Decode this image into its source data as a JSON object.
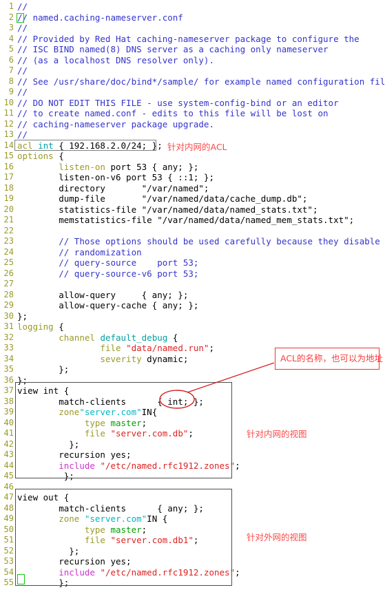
{
  "editor": {
    "name": "text-editor",
    "file_hint": "named.caching-nameserver.conf",
    "gutter_color": "#9a9a2a",
    "cursor_color": "#17c417",
    "annotation_color": "#fc4a4a"
  },
  "lines": [
    {
      "n": "1",
      "text": "//"
    },
    {
      "n": "2",
      "text": "// named.caching-nameserver.conf"
    },
    {
      "n": "3",
      "text": "//"
    },
    {
      "n": "4",
      "text": "// Provided by Red Hat caching-nameserver package to configure the"
    },
    {
      "n": "5",
      "text": "// ISC BIND named(8) DNS server as a caching only nameserver"
    },
    {
      "n": "6",
      "text": "// (as a localhost DNS resolver only)."
    },
    {
      "n": "7",
      "text": "//"
    },
    {
      "n": "8",
      "text": "// See /usr/share/doc/bind*/sample/ for example named configuration files."
    },
    {
      "n": "9",
      "text": "//"
    },
    {
      "n": "10",
      "text": "// DO NOT EDIT THIS FILE - use system-config-bind or an editor"
    },
    {
      "n": "11",
      "text": "// to create named.conf - edits to this file will be lost on"
    },
    {
      "n": "12",
      "text": "// caching-nameserver package upgrade."
    },
    {
      "n": "13",
      "text": "//"
    },
    {
      "n": "14",
      "text": "acl int { 192.168.2.0/24; };"
    },
    {
      "n": "15",
      "text": "options {"
    },
    {
      "n": "16",
      "text": "        listen-on port 53 { any; };"
    },
    {
      "n": "17",
      "text": "        listen-on-v6 port 53 { ::1; };"
    },
    {
      "n": "18",
      "text": "        directory       \"/var/named\";"
    },
    {
      "n": "19",
      "text": "        dump-file       \"/var/named/data/cache_dump.db\";"
    },
    {
      "n": "20",
      "text": "        statistics-file \"/var/named/data/named_stats.txt\";"
    },
    {
      "n": "21",
      "text": "        memstatistics-file \"/var/named/data/named_mem_stats.txt\";"
    },
    {
      "n": "22",
      "text": ""
    },
    {
      "n": "23",
      "text": "        // Those options should be used carefully because they disable port"
    },
    {
      "n": "24",
      "text": "        // randomization"
    },
    {
      "n": "25",
      "text": "        // query-source    port 53;"
    },
    {
      "n": "26",
      "text": "        // query-source-v6 port 53;"
    },
    {
      "n": "27",
      "text": ""
    },
    {
      "n": "28",
      "text": "        allow-query     { any; };"
    },
    {
      "n": "29",
      "text": "        allow-query-cache { any; };"
    },
    {
      "n": "30",
      "text": "};"
    },
    {
      "n": "31",
      "text": "logging {"
    },
    {
      "n": "32",
      "text": "        channel default_debug {"
    },
    {
      "n": "33",
      "text": "                file \"data/named.run\";"
    },
    {
      "n": "34",
      "text": "                severity dynamic;"
    },
    {
      "n": "35",
      "text": "        };"
    },
    {
      "n": "36",
      "text": "};"
    },
    {
      "n": "37",
      "text": "view int {"
    },
    {
      "n": "38",
      "text": "        match-clients      { int; };"
    },
    {
      "n": "39",
      "text": "        zone\"server.com\"IN{"
    },
    {
      "n": "40",
      "text": "             type master;"
    },
    {
      "n": "41",
      "text": "             file \"server.com.db\";"
    },
    {
      "n": "42",
      "text": "          };"
    },
    {
      "n": "43",
      "text": "        recursion yes;"
    },
    {
      "n": "44",
      "text": "        include \"/etc/named.rfc1912.zones\";"
    },
    {
      "n": "45",
      "text": "         };"
    },
    {
      "n": "46",
      "text": ""
    },
    {
      "n": "47",
      "text": "view out {"
    },
    {
      "n": "48",
      "text": "        match-clients      { any; };"
    },
    {
      "n": "49",
      "text": "        zone \"server.com\"IN {"
    },
    {
      "n": "50",
      "text": "             type master;"
    },
    {
      "n": "51",
      "text": "             file \"server.com.db1\";"
    },
    {
      "n": "52",
      "text": "          };"
    },
    {
      "n": "53",
      "text": "        recursion yes;"
    },
    {
      "n": "54",
      "text": "        include \"/etc/named.rfc1912.zones\";"
    },
    {
      "n": "55",
      "text": "        };"
    }
  ],
  "annotations": {
    "acl_note": "针对内网的ACL",
    "acl_name_note": "ACL的名称，也可以为地址",
    "view_int_note": "针对内网的视图",
    "view_out_note": "针对外网的视图"
  }
}
